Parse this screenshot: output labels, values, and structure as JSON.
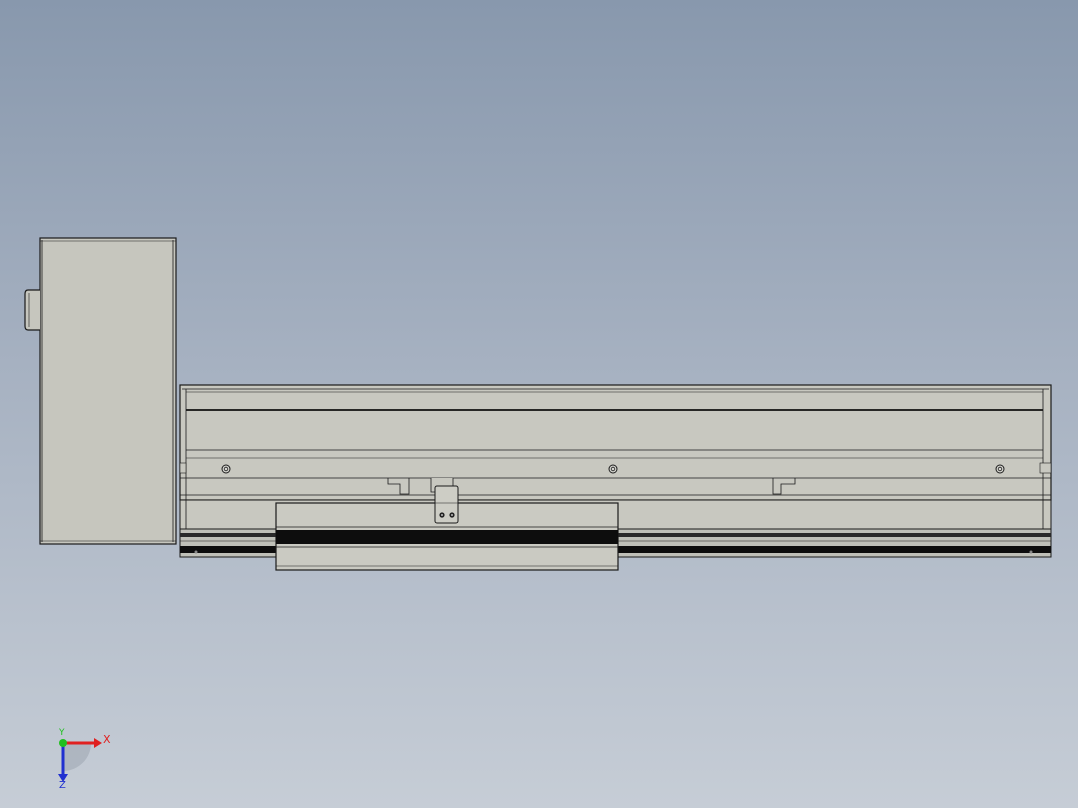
{
  "viewport": {
    "background_top": "#8898ad",
    "background_bottom": "#c6cdd6"
  },
  "model": {
    "body_color": "#c8c8c0",
    "edge_color": "#1a1a1a",
    "dark_band_color": "#0d0d0d",
    "parts": [
      "motor-housing",
      "rail-body",
      "carriage",
      "mounting-bracket"
    ]
  },
  "triad": {
    "x_label": "X",
    "y_label": "Y",
    "z_label": "Z",
    "x_color": "#e02020",
    "y_color": "#20c020",
    "z_color": "#2030d0"
  }
}
